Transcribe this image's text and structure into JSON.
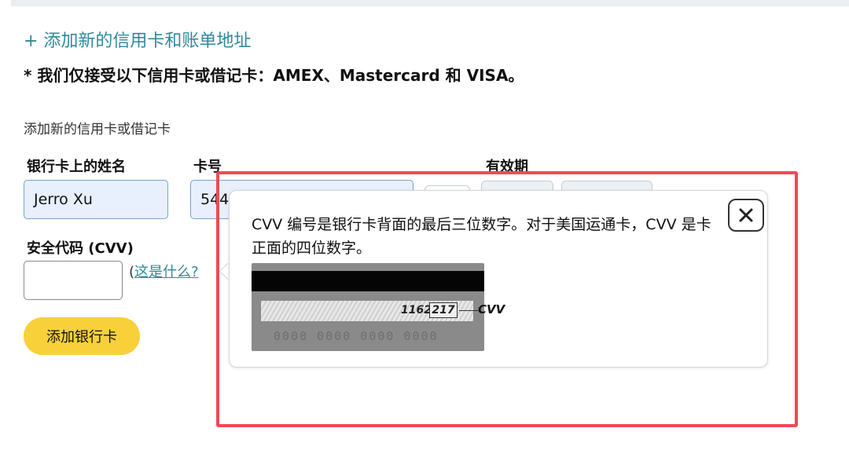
{
  "page": {
    "add_new_link": "+ 添加新的信用卡和账单地址",
    "accepted_cards_note": "* 我们仅接受以下信用卡或借记卡：AMEX、Mastercard 和 VISA。",
    "section_title": "添加新的信用卡或借记卡"
  },
  "form": {
    "name_label": "银行卡上的姓名",
    "name_value": "Jerro Xu",
    "card_number_label": "卡号",
    "card_number_value": "544",
    "expiry_label": "有效期",
    "cvv_label": "安全代码 (CVV)",
    "cvv_value": "",
    "whatis_open": "(",
    "whatis_link": "这是什么?",
    "add_button": "添加银行卡"
  },
  "popover": {
    "text": "CVV 编号是银行卡背面的最后三位数字。对于美国运通卡，CVV 是卡正面的四位数字。",
    "close_icon": "close-icon",
    "card_image": {
      "signature_digits": "1162",
      "cvv_digits": "217",
      "cvv_tag": "CVV",
      "card_number": "0000 0000 0000 0000"
    }
  },
  "highlight": {
    "color": "#ee4b55"
  }
}
